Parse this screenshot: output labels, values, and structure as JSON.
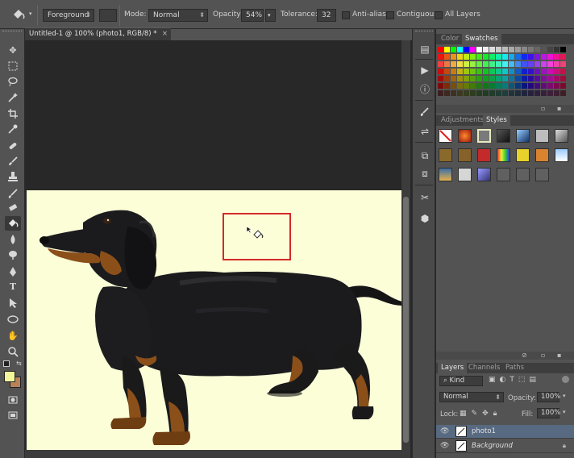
{
  "options_bar": {
    "fill_source": "Foreground",
    "mode_label": "Mode:",
    "mode_value": "Normal",
    "opacity_label": "Opacity:",
    "opacity_value": "54%",
    "tolerance_label": "Tolerance:",
    "tolerance_value": "32",
    "antialias_label": "Anti-alias",
    "contiguous_label": "Contiguous",
    "all_layers_label": "All Layers"
  },
  "document": {
    "tab_title": "Untitled-1 @ 100% (photo1, RGB/8) *",
    "close_glyph": "×"
  },
  "tools": [
    "move-tool",
    "marquee-tool",
    "lasso-tool",
    "magic-wand-tool",
    "crop-tool",
    "eyedropper-tool",
    "healing-brush-tool",
    "brush-tool",
    "clone-stamp-tool",
    "history-brush-tool",
    "eraser-tool",
    "paint-bucket-tool",
    "blur-tool",
    "dodge-tool",
    "pen-tool",
    "type-tool",
    "path-selection-tool",
    "shape-tool",
    "hand-tool",
    "zoom-tool"
  ],
  "colors": {
    "foreground": "#f3f59a",
    "background": "#b8835a",
    "canvas": "#fcfed8",
    "highlight_box": "#d42a2a"
  },
  "panels": {
    "color_tab": "Color",
    "swatches_tab": "Swatches",
    "adjustments_tab": "Adjustments",
    "styles_tab": "Styles",
    "layers_tab": "Layers",
    "channels_tab": "Channels",
    "paths_tab": "Paths"
  },
  "layers_panel": {
    "kind_label": "Kind",
    "blend_mode": "Normal",
    "opacity_label": "Opacity:",
    "opacity_value": "100%",
    "lock_label": "Lock:",
    "fill_label": "Fill:",
    "fill_value": "100%",
    "layers": [
      {
        "name": "photo1",
        "selected": true
      },
      {
        "name": "Background",
        "selected": false,
        "locked": true
      }
    ]
  }
}
